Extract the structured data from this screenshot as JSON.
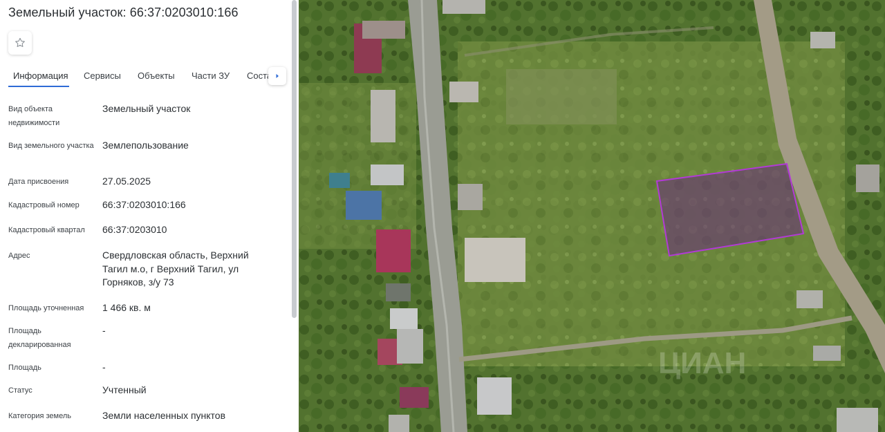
{
  "panel": {
    "title": "Земельный участок: 66:37:0203010:166",
    "favorite_icon": "star-outline-icon",
    "tabs": [
      {
        "label": "Информация",
        "active": true
      },
      {
        "label": "Сервисы",
        "active": false
      },
      {
        "label": "Объекты",
        "active": false
      },
      {
        "label": "Части ЗУ",
        "active": false
      },
      {
        "label": "Соста",
        "active": false
      }
    ],
    "tab_scroll_icon": "chevron-right-icon",
    "rows": [
      {
        "label": "Вид объекта недвижимости",
        "value": "Земельный участок"
      },
      {
        "label": "Вид земельного участка",
        "value": "Землепользование"
      },
      {
        "label": "Дата присвоения",
        "value": "27.05.2025"
      },
      {
        "label": "Кадастровый номер",
        "value": "66:37:0203010:166"
      },
      {
        "label": "Кадастровый квартал",
        "value": "66:37:0203010"
      },
      {
        "label": "Адрес",
        "value": "Свердловская область, Верхний Тагил м.о, г Верхний Тагил, ул Горняков, з/у 73"
      },
      {
        "label": "Площадь уточненная",
        "value": "1 466 кв. м"
      },
      {
        "label": "Площадь декларированная",
        "value": "-"
      },
      {
        "label": "Площадь",
        "value": "-"
      },
      {
        "label": "Статус",
        "value": "Учтенный"
      },
      {
        "label": "Категория земель",
        "value": "Земли населенных пунктов"
      }
    ]
  },
  "map": {
    "highlight_color": "#b23ad6",
    "watermark_text": "ЦИАН"
  }
}
